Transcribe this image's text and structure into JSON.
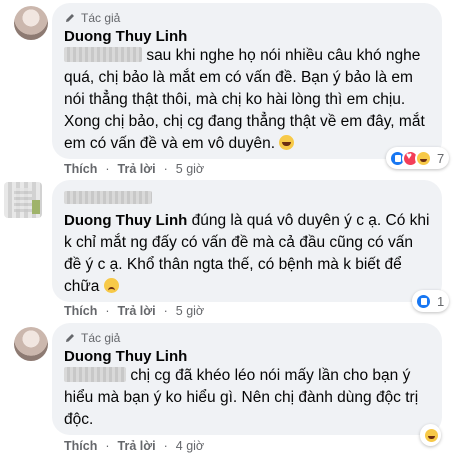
{
  "comments": [
    {
      "badge": "Tác giả",
      "author": "Duong Thuy Linh",
      "text_line1_rest": "sau khi nghe họ nói nhiều câu khó nghe",
      "text_rest": "quá, chị bảo là mắt em có vấn đề. Bạn ý bảo là em nói thẳng thật thôi, mà chị ko hài lòng thì em chịu. Xong chị bảo, chị cg đang thẳng thật về em đây, mắt em có vấn đề và em vô duyên.",
      "actions": {
        "like": "Thích",
        "reply": "Trả lời",
        "time": "5 giờ"
      },
      "reaction_count": "7",
      "reaction_icons": [
        "like-icon",
        "love-icon",
        "haha-icon"
      ]
    },
    {
      "author": "Duong Thuy Linh",
      "text_rest": "đúng là quá vô duyên ý c ạ. Có khi k chỉ mắt ng đấy có vấn đề mà cả đầu cũng có vấn đề ý c ạ. Khổ thân ngta thế, có bệnh mà k biết để chữa",
      "actions": {
        "like": "Thích",
        "reply": "Trả lời",
        "time": "5 giờ"
      },
      "reaction_count": "1",
      "reaction_icons": [
        "like-icon"
      ]
    },
    {
      "badge": "Tác giả",
      "author": "Duong Thuy Linh",
      "text_line1_rest": "chị cg đã khéo léo nói mấy lần cho bạn ý",
      "text_rest": "hiểu mà bạn ý ko hiểu gì. Nên chị đành dùng độc trị độc.",
      "actions": {
        "like": "Thích",
        "reply": "Trả lời",
        "time": "4 giờ"
      },
      "reaction_count": "",
      "reaction_icons": [
        "haha-icon"
      ]
    }
  ],
  "colors": {
    "bubble": "#f0f2f5",
    "meta": "#65676b",
    "like": "#1877f2"
  }
}
